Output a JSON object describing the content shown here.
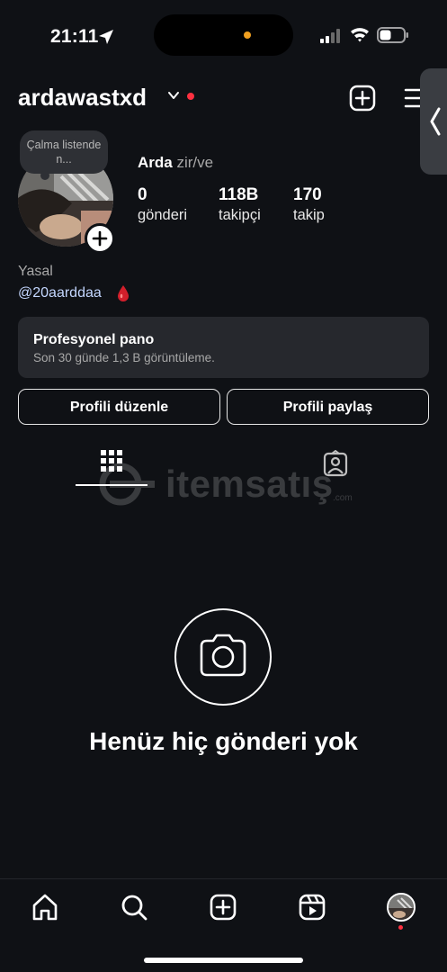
{
  "status_bar": {
    "time": "21:11"
  },
  "header": {
    "username": "ardawastxd"
  },
  "profile": {
    "note": "Çalma listende n...",
    "full_name": "Arda",
    "pronoun_text": "zir/ve",
    "stats": [
      {
        "value": "0",
        "label": "gönderi"
      },
      {
        "value": "118B",
        "label": "takipçi"
      },
      {
        "value": "170",
        "label": "takip"
      }
    ],
    "bio_category": "Yasal",
    "bio_link": "@20aarddaa"
  },
  "pro_dashboard": {
    "title": "Profesyonel pano",
    "subtitle": "Son 30 günde 1,3 B görüntüleme."
  },
  "buttons": {
    "edit_profile": "Profili düzenle",
    "share_profile": "Profili paylaş"
  },
  "watermark": {
    "brand": "itemsatış",
    "domain": ".com"
  },
  "empty_state": {
    "text": "Henüz hiç gönderi yok"
  },
  "icons": {
    "header": [
      "chevron-down-icon",
      "add-icon",
      "menu-icon"
    ],
    "tabs": [
      "grid-icon",
      "tagged-icon"
    ],
    "nav": [
      "home-icon",
      "search-icon",
      "create-icon",
      "reels-icon",
      "profile-avatar"
    ]
  },
  "colors": {
    "background": "#0f1115",
    "accent_red": "#ff3040",
    "link": "#c4d7ff",
    "card": "#26282d"
  }
}
